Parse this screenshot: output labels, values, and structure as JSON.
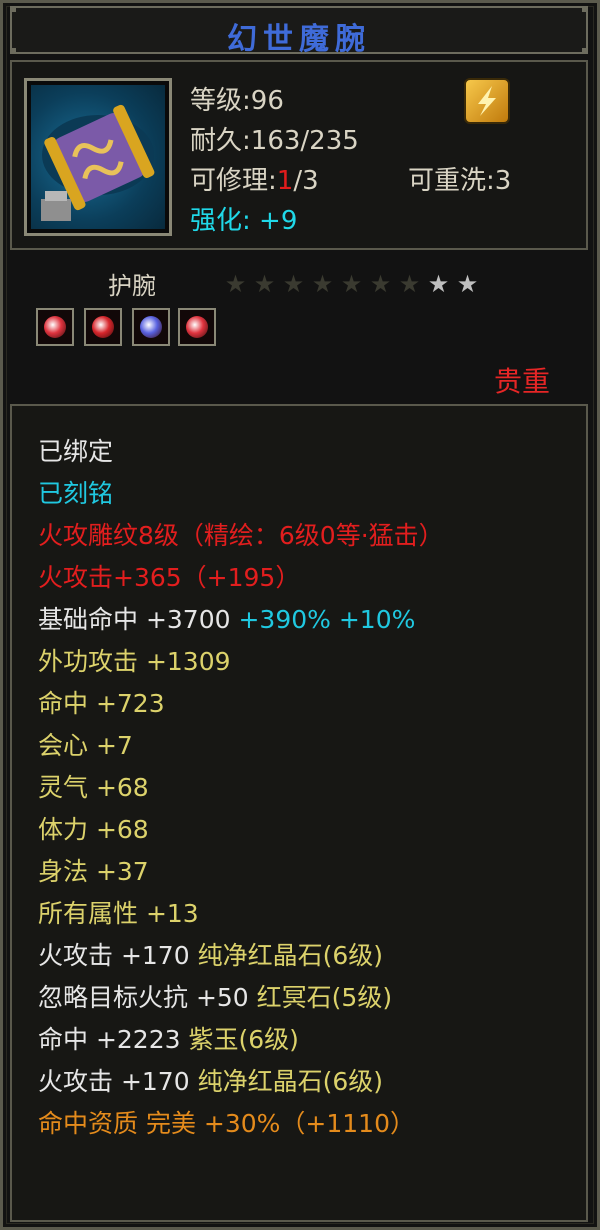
{
  "item": {
    "name": "幻世魔腕",
    "level_label": "等级",
    "level": "96",
    "durability_label": "耐久",
    "durability": "163/235",
    "repair_label": "可修理",
    "repair_current": "1",
    "repair_max": "/3",
    "rewash_label": "可重洗",
    "rewash": "3",
    "enhance_label": "强化:",
    "enhance": "+9",
    "slot_type": "护腕",
    "quality": "贵重",
    "stars_total": 9,
    "stars_lit": 2
  },
  "gems": [
    {
      "name": "red-gem",
      "color": "#e0343f"
    },
    {
      "name": "red-gem",
      "color": "#d7262c"
    },
    {
      "name": "blue-gem",
      "color": "#5861e0"
    },
    {
      "name": "red-gem",
      "color": "#e0343f"
    }
  ],
  "lines": [
    {
      "text": "已绑定",
      "class": "white"
    },
    {
      "text": "已刻铭",
      "class": "cyan"
    },
    {
      "text": "火攻雕纹8级（精绘：6级0等·猛击）",
      "class": "red"
    },
    {
      "text": "火攻击+365（+195）",
      "class": "red"
    },
    {
      "text": "基础命中 +3700",
      "extra": " +390% +10%",
      "class": "white",
      "extra_class": "cyan"
    },
    {
      "text": "外功攻击 +1309",
      "class": "yellow"
    },
    {
      "text": "命中 +723",
      "class": "yellow"
    },
    {
      "text": "会心 +7",
      "class": "yellow"
    },
    {
      "text": "灵气 +68",
      "class": "yellow"
    },
    {
      "text": "体力 +68",
      "class": "yellow"
    },
    {
      "text": "身法 +37",
      "class": "yellow"
    },
    {
      "text": "所有属性 +13",
      "class": "yellow"
    },
    {
      "text": "火攻击 +170 ",
      "extra": "纯净红晶石(6级)",
      "class": "white",
      "extra_class": "yellow"
    },
    {
      "text": "忽略目标火抗 +50 ",
      "extra": "红冥石(5级)",
      "class": "white",
      "extra_class": "yellow"
    },
    {
      "text": "命中 +2223 ",
      "extra": "紫玉(6级)",
      "class": "white",
      "extra_class": "yellow"
    },
    {
      "text": "火攻击 +170 ",
      "extra": "纯净红晶石(6级)",
      "class": "white",
      "extra_class": "yellow"
    },
    {
      "text": "命中资质  完美 +30%（+1110）",
      "class": "orange"
    }
  ]
}
